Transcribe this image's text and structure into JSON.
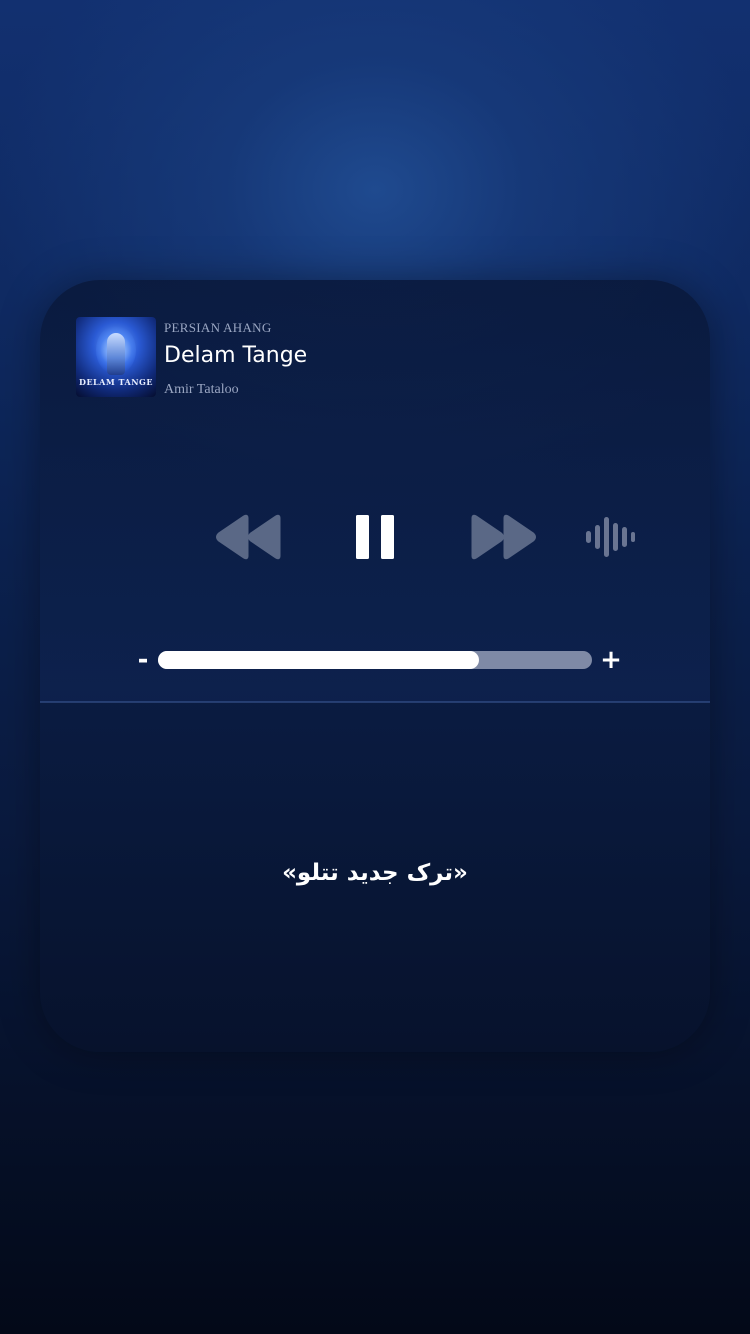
{
  "player": {
    "source": "PERSIAN AHANG",
    "title": "Delam Tange",
    "artist": "Amir Tataloo",
    "cover_text": "DELAM TANGE",
    "controls": {
      "rewind_icon": "rewind-icon",
      "pause_icon": "pause-icon",
      "forward_icon": "fast-forward-icon",
      "audio_icon": "audio-waveform-icon"
    },
    "volume": {
      "minus_label": "-",
      "plus_label": "+",
      "level": 0.74
    }
  },
  "lyric": "«ترک جدید تتلو»",
  "colors": {
    "accent": "#ffffff",
    "icon_inactive": "#5a6886",
    "track": "#7f8aa6"
  }
}
